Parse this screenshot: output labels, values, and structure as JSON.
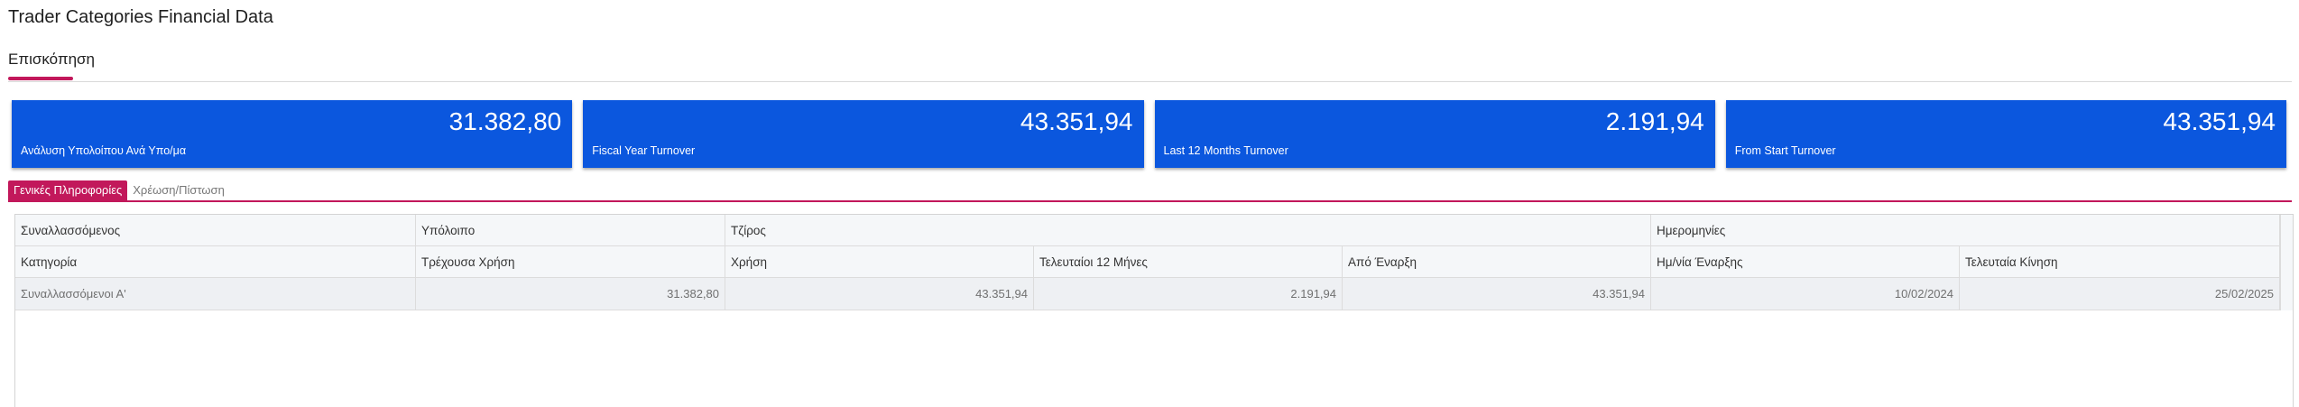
{
  "page": {
    "title": "Trader Categories Financial Data"
  },
  "top_tab": {
    "label": "Επισκόπηση"
  },
  "cards": [
    {
      "value": "31.382,80",
      "label": "Ανάλυση Υπολοίπου Ανά Υπο/μα"
    },
    {
      "value": "43.351,94",
      "label": "Fiscal Year Turnover"
    },
    {
      "value": "2.191,94",
      "label": "Last 12 Months Turnover"
    },
    {
      "value": "43.351,94",
      "label": "From Start Turnover"
    }
  ],
  "subtabs": [
    {
      "label": "Γενικές Πληροφορίες",
      "active": true
    },
    {
      "label": "Χρέωση/Πίστωση",
      "active": false
    }
  ],
  "table": {
    "group_headers": [
      "Συναλλασσόμενος",
      "Υπόλοιπο",
      "Τζίρος",
      "Ημερομηνίες"
    ],
    "columns": [
      "Κατηγορία",
      "Τρέχουσα Χρήση",
      "Χρήση",
      "Τελευταίοι 12 Μήνες",
      "Από Έναρξη",
      "Ημ/νία Έναρξης",
      "Τελευταία Κίνηση"
    ],
    "rows": [
      [
        "Συναλλασσόμενοι Α'",
        "31.382,80",
        "43.351,94",
        "2.191,94",
        "43.351,94",
        "10/02/2024",
        "25/02/2025"
      ]
    ]
  },
  "colors": {
    "primary": "#0b57de",
    "accent": "#c2185b"
  }
}
